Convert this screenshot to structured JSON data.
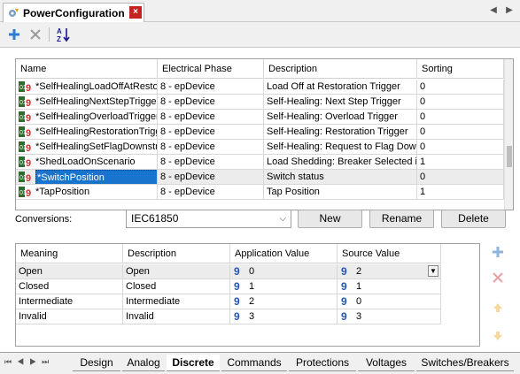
{
  "window": {
    "title": "PowerConfiguration"
  },
  "toolbar": {
    "add_icon": "plus-icon",
    "delete_icon": "x-icon",
    "sort_icon": "sort-az-icon"
  },
  "main_grid": {
    "columns": [
      "Name",
      "Electrical Phase",
      "Description",
      "Sorting"
    ],
    "rows": [
      {
        "name": "*SelfHealingLoadOffAtRestora",
        "phase": "8 - epDevice",
        "description": "Load Off at Restoration Trigger",
        "sorting": "0"
      },
      {
        "name": "*SelfHealingNextStepTrigger",
        "phase": "8 - epDevice",
        "description": "Self-Healing: Next Step Trigger",
        "sorting": "0"
      },
      {
        "name": "*SelfHealingOverloadTrigger",
        "phase": "8 - epDevice",
        "description": "Self-Healing: Overload Trigger",
        "sorting": "0"
      },
      {
        "name": "*SelfHealingRestorationTrigg",
        "phase": "8 - epDevice",
        "description": "Self-Healing: Restoration Trigger",
        "sorting": "0"
      },
      {
        "name": "*SelfHealingSetFlagDownstre",
        "phase": "8 - epDevice",
        "description": "Self-Healing: Request to Flag Down",
        "sorting": "0"
      },
      {
        "name": "*ShedLoadOnScenario",
        "phase": "8 - epDevice",
        "description": "Load Shedding: Breaker Selected in",
        "sorting": "1"
      },
      {
        "name": "*SwitchPosition",
        "phase": "8 - epDevice",
        "description": "Switch status",
        "sorting": "0"
      },
      {
        "name": "*TapPosition",
        "phase": "8 - epDevice",
        "description": "Tap Position",
        "sorting": "1"
      }
    ]
  },
  "conversions": {
    "label": "Conversions:",
    "selected": "IEC61850",
    "new_label": "New",
    "rename_label": "Rename",
    "delete_label": "Delete"
  },
  "conv_grid": {
    "columns": [
      "Meaning",
      "Description",
      "Application Value",
      "Source Value"
    ],
    "rows": [
      {
        "meaning": "Open",
        "description": "Open",
        "app": "0",
        "src": "2"
      },
      {
        "meaning": "Closed",
        "description": "Closed",
        "app": "1",
        "src": "1"
      },
      {
        "meaning": "Intermediate",
        "description": "Intermediate",
        "app": "2",
        "src": "0"
      },
      {
        "meaning": "Invalid",
        "description": "Invalid",
        "app": "3",
        "src": "3"
      }
    ]
  },
  "bottom_tabs": [
    "Design",
    "Analog",
    "Discrete",
    "Commands",
    "Protections",
    "Voltages",
    "Switches/Breakers"
  ],
  "active_tab": "Discrete",
  "colors": {
    "accent": "#1874cd",
    "close": "#c4241f",
    "add": "#2a7fd4",
    "delete_red": "#d9322b",
    "arrow_orange": "#f0b030"
  }
}
